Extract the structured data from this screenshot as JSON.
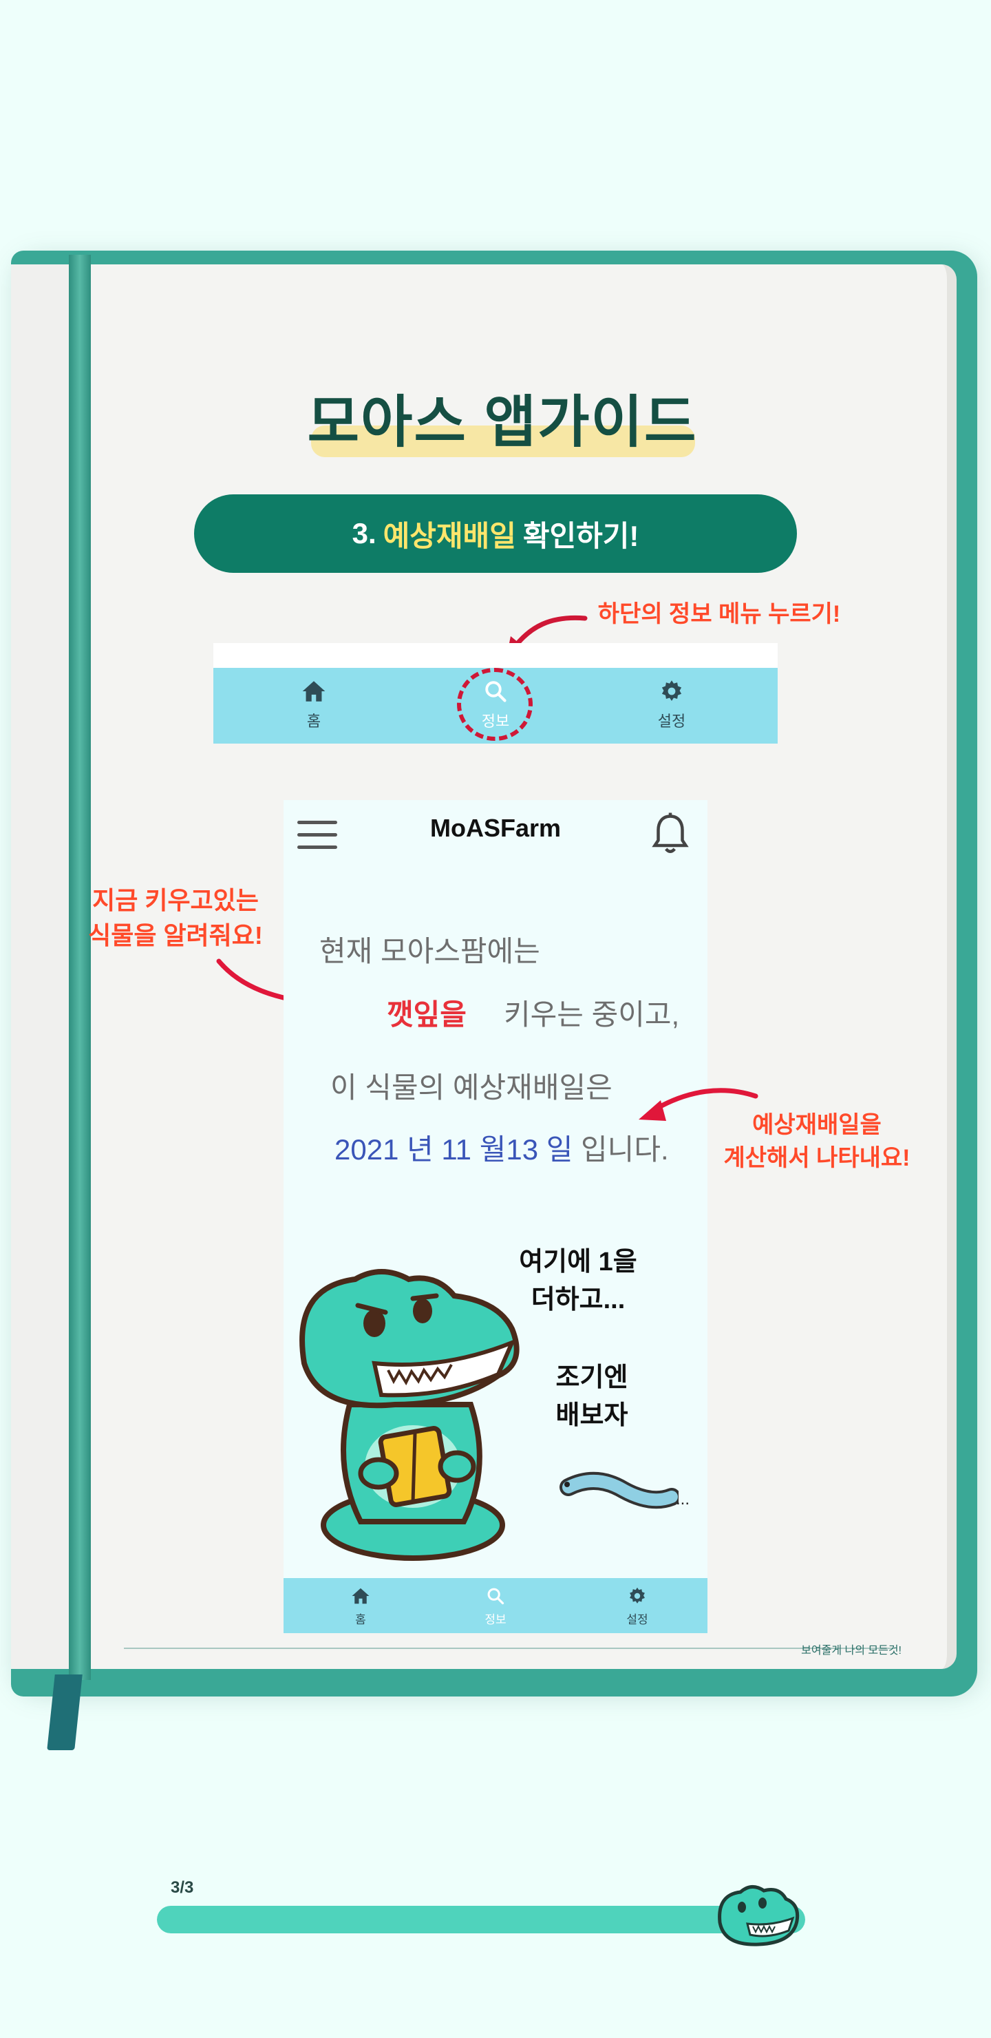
{
  "title": "모아스 앱가이드",
  "step": {
    "number": "3.",
    "highlight": "예상재배일",
    "rest": "확인하기!"
  },
  "annotations": {
    "nav_hint": "하단의 정보 메뉴 누르기!",
    "plant_hint_line1": "지금 키우고있는",
    "plant_hint_line2": "식물을 알려줘요!",
    "date_hint_line1": "예상재배일을",
    "date_hint_line2": "계산해서 나타내요!"
  },
  "nav": {
    "home": "홈",
    "info": "정보",
    "settings": "설정"
  },
  "phone": {
    "brand": "MoASFarm",
    "line1": "현재 모아스팜에는",
    "plant": "깻잎을",
    "line2_rest": "키우는 중이고,",
    "line3": "이 식물의 예상재배일은",
    "date_year": "2021",
    "date_year_unit": "년",
    "date_month": "11",
    "date_month_unit": "월",
    "date_day": "13",
    "date_day_unit": "일",
    "date_suffix": "입니다.",
    "speech1_line1": "여기에 1을",
    "speech1_line2": "더하고...",
    "speech2_line1": "조기엔",
    "speech2_line2": "배보자",
    "ellipsis": "..."
  },
  "footer": "보여줄게 나의 모든것!",
  "progress": {
    "label": "3/3",
    "fraction": 1.0
  },
  "colors": {
    "accent": "#0e7c66",
    "highlight": "#ffe66c",
    "annotation": "#ff4a2a",
    "nav_bg": "#8fdfed",
    "progress": "#4fd3bc"
  }
}
